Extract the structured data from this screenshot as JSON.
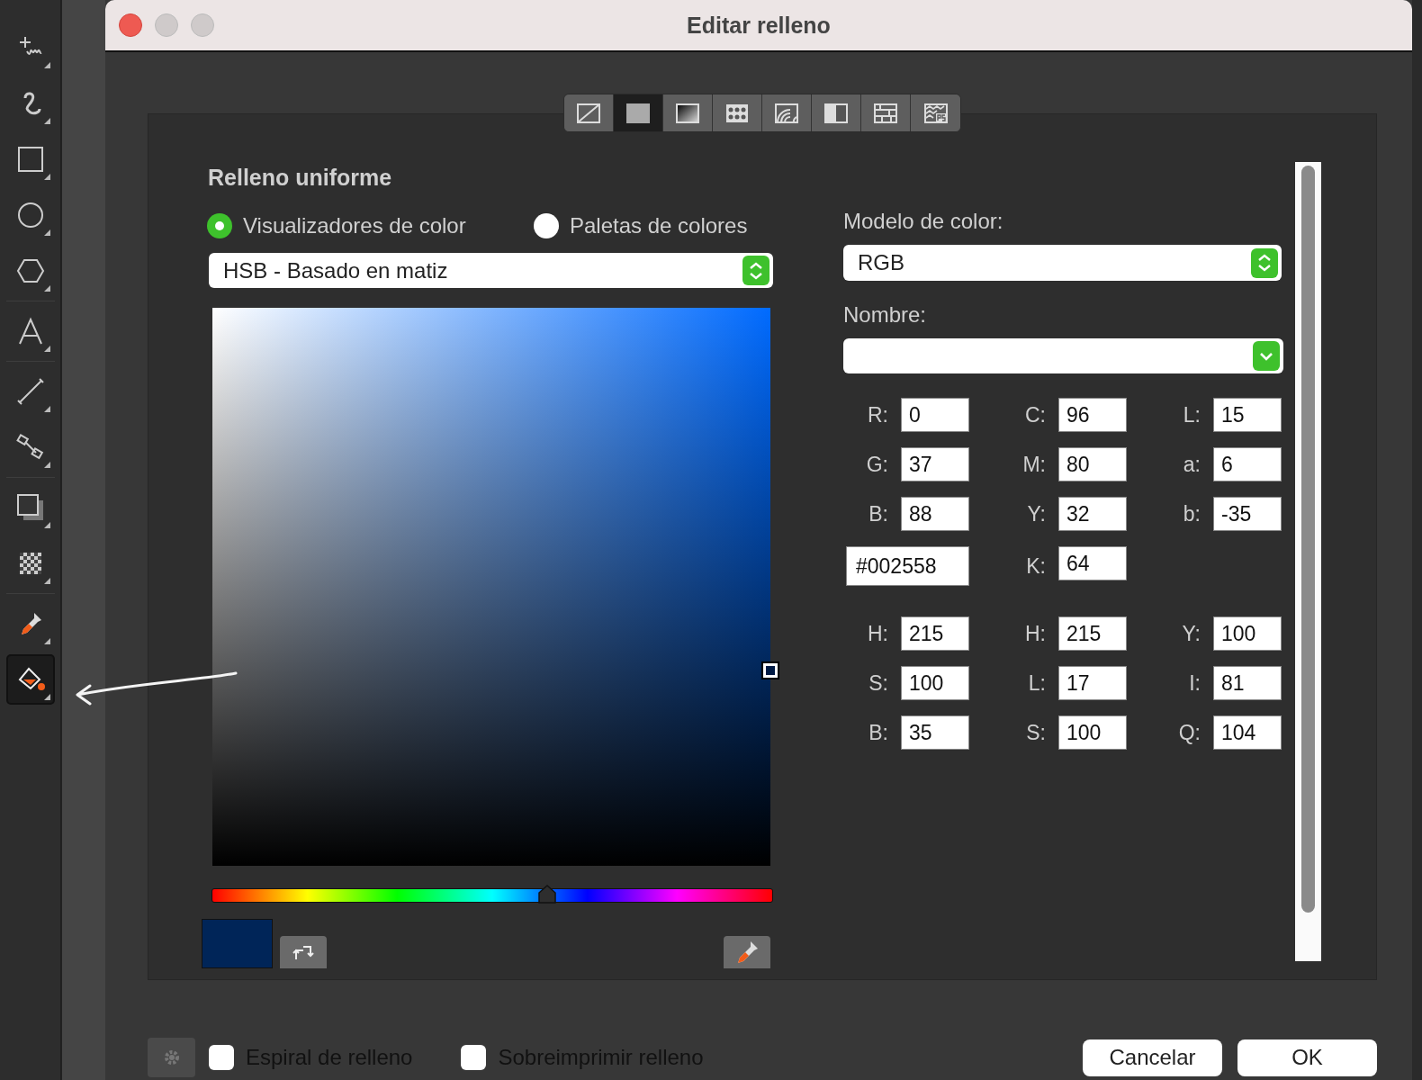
{
  "tools": [
    {
      "kind": "freehand",
      "selected": false
    },
    {
      "kind": "curve",
      "selected": false
    },
    {
      "kind": "rectangle",
      "selected": false
    },
    {
      "kind": "ellipse",
      "selected": false
    },
    {
      "kind": "polygon",
      "selected": false
    },
    {
      "kind": "text",
      "selected": false
    },
    {
      "kind": "line",
      "selected": false
    },
    {
      "kind": "connector",
      "selected": false
    },
    {
      "kind": "shadow",
      "selected": false
    },
    {
      "kind": "transparency",
      "selected": false
    },
    {
      "kind": "eyedropper",
      "selected": false
    },
    {
      "kind": "fill",
      "selected": true
    }
  ],
  "window": {
    "title": "Editar relleno"
  },
  "fill_types": [
    {
      "kind": "none",
      "selected": false
    },
    {
      "kind": "uniform",
      "selected": true
    },
    {
      "kind": "gradient",
      "selected": false
    },
    {
      "kind": "vector",
      "selected": false
    },
    {
      "kind": "bitmap",
      "selected": false
    },
    {
      "kind": "two_color",
      "selected": false
    },
    {
      "kind": "texture",
      "selected": false
    },
    {
      "kind": "postscript",
      "selected": false
    }
  ],
  "section_title": "Relleno uniforme",
  "modes": [
    {
      "label": "Visualizadores de color",
      "selected": true
    },
    {
      "label": "Paletas de colores",
      "selected": false
    }
  ],
  "viewer_select": {
    "value": "HSB - Basado en matiz"
  },
  "hue": {
    "level": 0.597
  },
  "color_model": {
    "label": "Modelo de color:",
    "value": "RGB"
  },
  "name_field": {
    "label": "Nombre:"
  },
  "field_rows": [
    [
      {
        "kind": "labeled",
        "label": "R:",
        "value": "0"
      },
      {
        "kind": "labeled",
        "label": "C:",
        "value": "96"
      },
      {
        "kind": "labeled",
        "label": "L:",
        "value": "15"
      }
    ],
    [
      {
        "kind": "labeled",
        "label": "G:",
        "value": "37"
      },
      {
        "kind": "labeled",
        "label": "M:",
        "value": "80"
      },
      {
        "kind": "labeled",
        "label": "a:",
        "value": "6"
      }
    ],
    [
      {
        "kind": "labeled",
        "label": "B:",
        "value": "88"
      },
      {
        "kind": "labeled",
        "label": "Y:",
        "value": "32"
      },
      {
        "kind": "labeled",
        "label": "b:",
        "value": "-35"
      }
    ],
    [
      {
        "kind": "hex",
        "value": "#002558"
      },
      {
        "kind": "labeled",
        "label": "K:",
        "value": "64"
      }
    ],
    [
      {
        "kind": "labeled",
        "label": "H:",
        "value": "215"
      },
      {
        "kind": "labeled",
        "label": "H:",
        "value": "215"
      },
      {
        "kind": "labeled",
        "label": "Y:",
        "value": "100"
      }
    ],
    [
      {
        "kind": "labeled",
        "label": "S:",
        "value": "100"
      },
      {
        "kind": "labeled",
        "label": "L:",
        "value": "17"
      },
      {
        "kind": "labeled",
        "label": "I:",
        "value": "81"
      }
    ],
    [
      {
        "kind": "labeled",
        "label": "B:",
        "value": "35"
      },
      {
        "kind": "labeled",
        "label": "S:",
        "value": "100"
      },
      {
        "kind": "labeled",
        "label": "Q:",
        "value": "104"
      }
    ]
  ],
  "options": [
    {
      "label": "Espiral de relleno",
      "checked": false
    },
    {
      "label": "Sobreimprimir relleno",
      "checked": false
    }
  ],
  "buttons": [
    "Cancelar",
    "OK"
  ]
}
